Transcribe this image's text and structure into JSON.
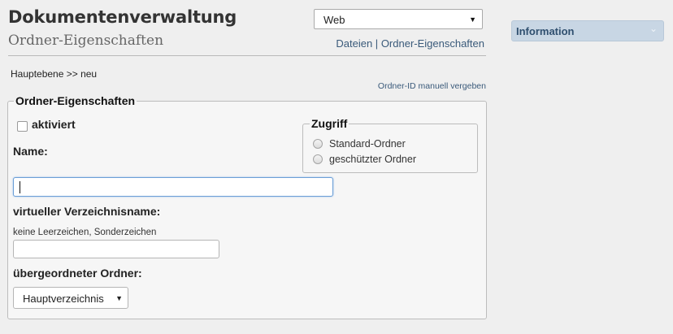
{
  "header": {
    "title": "Dokumentenverwaltung",
    "subtitle": "Ordner-Eigenschaften",
    "site_select_value": "Web",
    "links": {
      "files": "Dateien",
      "separator": "|",
      "folder_properties": "Ordner-Eigenschaften"
    }
  },
  "breadcrumb": "Hauptebene >> neu",
  "manual_id_link": "Ordner-ID manuell vergeben",
  "form": {
    "legend": "Ordner-Eigenschaften",
    "activated": {
      "label": "aktiviert",
      "checked": false
    },
    "name": {
      "label": "Name:",
      "value": ""
    },
    "virtual_name": {
      "label": "virtueller Verzeichnisname:",
      "hint": "keine Leerzeichen, Sonderzeichen",
      "value": ""
    },
    "parent": {
      "label": "übergeordneter Ordner:",
      "selected": "Hauptverzeichnis"
    },
    "access": {
      "legend": "Zugriff",
      "options": [
        "Standard-Ordner",
        "geschützter Ordner"
      ]
    }
  },
  "info_panel": {
    "title": "Information",
    "icon": "chevron-down-icon"
  }
}
